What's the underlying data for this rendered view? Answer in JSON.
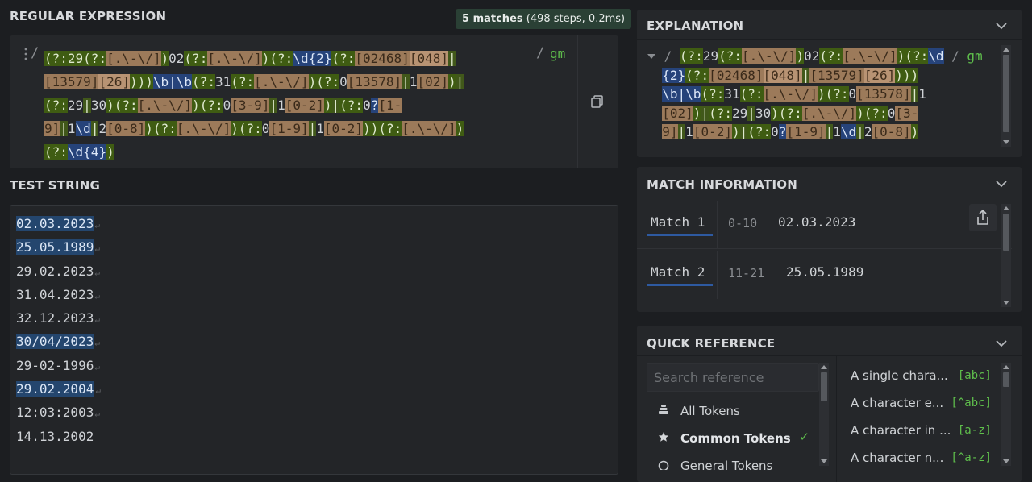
{
  "regex": {
    "title": "REGULAR EXPRESSION",
    "badge_count": "5 matches",
    "badge_detail": " (498 steps, 0.2ms)",
    "delimiter_open": "/",
    "delimiter_close": "/",
    "flags": "gm",
    "lines": [
      [
        [
          "g",
          "(?:"
        ],
        [
          "g",
          "29"
        ],
        [
          "g",
          "(?:"
        ],
        [
          "c",
          "[.\\-\\/]"
        ],
        [
          "g",
          ")"
        ],
        [
          "p",
          "02"
        ],
        [
          "g",
          "(?:"
        ],
        [
          "c",
          "[.\\-\\/]"
        ],
        [
          "g",
          ")"
        ],
        [
          "g",
          "(?:"
        ],
        [
          "b",
          "\\d{2}"
        ],
        [
          "g",
          "(?:"
        ],
        [
          "c",
          "[02468]"
        ],
        [
          "c2",
          "[048]"
        ],
        [
          "pipe",
          "|"
        ]
      ],
      [
        [
          "c",
          "[13579]"
        ],
        [
          "c2",
          "[26]"
        ],
        [
          "g",
          ")))"
        ],
        [
          "b",
          "\\b|\\b"
        ],
        [
          "g",
          "(?:"
        ],
        [
          "p",
          "31"
        ],
        [
          "g",
          "(?:"
        ],
        [
          "c",
          "[.\\-\\/]"
        ],
        [
          "g",
          ")"
        ],
        [
          "g",
          "(?:"
        ],
        [
          "p",
          "0"
        ],
        [
          "c",
          "[13578]"
        ],
        [
          "pipe",
          "|"
        ],
        [
          "p",
          "1"
        ],
        [
          "c",
          "[02]"
        ],
        [
          "g",
          ")"
        ],
        [
          "pipe",
          "|"
        ]
      ],
      [
        [
          "g",
          "(?:"
        ],
        [
          "p",
          "29"
        ],
        [
          "pipe",
          "|"
        ],
        [
          "p",
          "30"
        ],
        [
          "g",
          ")"
        ],
        [
          "g",
          "(?:"
        ],
        [
          "c",
          "[.\\-\\/]"
        ],
        [
          "g",
          ")"
        ],
        [
          "g",
          "(?:"
        ],
        [
          "p",
          "0"
        ],
        [
          "c",
          "[3-9]"
        ],
        [
          "pipe",
          "|"
        ],
        [
          "p",
          "1"
        ],
        [
          "c",
          "[0-2]"
        ],
        [
          "g",
          ")"
        ],
        [
          "pipe",
          "|"
        ],
        [
          "g",
          "(?:"
        ],
        [
          "p",
          "0"
        ],
        [
          "b",
          "?"
        ],
        [
          "c",
          "[1-"
        ]
      ],
      [
        [
          "c",
          "9]"
        ],
        [
          "pipe",
          "|"
        ],
        [
          "p",
          "1"
        ],
        [
          "b",
          "\\d"
        ],
        [
          "pipe",
          "|"
        ],
        [
          "p",
          "2"
        ],
        [
          "c",
          "[0-8]"
        ],
        [
          "g",
          ")"
        ],
        [
          "g",
          "(?:"
        ],
        [
          "c",
          "[.\\-\\/]"
        ],
        [
          "g",
          ")"
        ],
        [
          "g",
          "(?:"
        ],
        [
          "p",
          "0"
        ],
        [
          "c",
          "[1-9]"
        ],
        [
          "pipe",
          "|"
        ],
        [
          "p",
          "1"
        ],
        [
          "c",
          "[0-2]"
        ],
        [
          "g",
          "))"
        ],
        [
          "g",
          "(?:"
        ],
        [
          "c",
          "[.\\-\\/]"
        ],
        [
          "g",
          ")"
        ]
      ],
      [
        [
          "g",
          "(?:"
        ],
        [
          "b",
          "\\d{4}"
        ],
        [
          "g",
          ")"
        ]
      ]
    ]
  },
  "test_string": {
    "title": "TEST STRING",
    "lines": [
      {
        "text": "02.03.2023",
        "match": true
      },
      {
        "text": "25.05.1989",
        "match": true
      },
      {
        "text": "29.02.2023",
        "match": false
      },
      {
        "text": "31.04.2023",
        "match": false
      },
      {
        "text": "32.12.2023",
        "match": false
      },
      {
        "text": "30/04/2023",
        "match": true
      },
      {
        "text": "29-02-1996",
        "match": false
      },
      {
        "text": "29.02.2004",
        "match": true
      },
      {
        "text": "12:03:2003",
        "match": false
      },
      {
        "text": "14.13.2002",
        "match": false
      }
    ],
    "newline_glyph": "↵"
  },
  "explanation": {
    "title": "EXPLANATION",
    "flags": "gm",
    "lines": [
      [
        [
          "g",
          "(?:"
        ],
        [
          "p",
          "29"
        ],
        [
          "g",
          "(?:"
        ],
        [
          "c",
          "[.\\-\\/]"
        ],
        [
          "g",
          ")"
        ],
        [
          "p",
          "02"
        ],
        [
          "g",
          "(?:"
        ],
        [
          "c",
          "[.\\-\\/]"
        ],
        [
          "g",
          ")"
        ],
        [
          "g",
          "(?:"
        ],
        [
          "b",
          "\\d"
        ]
      ],
      [
        [
          "b",
          "{2}"
        ],
        [
          "g",
          "(?:"
        ],
        [
          "c",
          "[02468]"
        ],
        [
          "c2",
          "[048]"
        ],
        [
          "pipe",
          "|"
        ],
        [
          "c",
          "[13579]"
        ],
        [
          "c2",
          "[26]"
        ],
        [
          "g",
          ")))"
        ]
      ],
      [
        [
          "b",
          "\\b|\\b"
        ],
        [
          "g",
          "(?:"
        ],
        [
          "p",
          "31"
        ],
        [
          "g",
          "(?:"
        ],
        [
          "c",
          "[.\\-\\/]"
        ],
        [
          "g",
          ")"
        ],
        [
          "g",
          "(?:"
        ],
        [
          "p",
          "0"
        ],
        [
          "c",
          "[13578]"
        ],
        [
          "pipe",
          "|"
        ],
        [
          "p",
          "1"
        ]
      ],
      [
        [
          "c",
          "[02]"
        ],
        [
          "g",
          ")"
        ],
        [
          "pipe",
          "|"
        ],
        [
          "g",
          "(?:"
        ],
        [
          "p",
          "29"
        ],
        [
          "pipe",
          "|"
        ],
        [
          "p",
          "30"
        ],
        [
          "g",
          ")"
        ],
        [
          "g",
          "(?:"
        ],
        [
          "c",
          "[.\\-\\/]"
        ],
        [
          "g",
          ")"
        ],
        [
          "g",
          "(?:"
        ],
        [
          "p",
          "0"
        ],
        [
          "c",
          "[3-"
        ]
      ],
      [
        [
          "c",
          "9]"
        ],
        [
          "pipe",
          "|"
        ],
        [
          "p",
          "1"
        ],
        [
          "c",
          "[0-2]"
        ],
        [
          "g",
          ")"
        ],
        [
          "pipe",
          "|"
        ],
        [
          "g",
          "(?:"
        ],
        [
          "p",
          "0"
        ],
        [
          "b",
          "?"
        ],
        [
          "c",
          "[1-9]"
        ],
        [
          "pipe",
          "|"
        ],
        [
          "p",
          "1"
        ],
        [
          "b",
          "\\d"
        ],
        [
          "pipe",
          "|"
        ],
        [
          "p",
          "2"
        ],
        [
          "c",
          "[0-8]"
        ],
        [
          "g",
          ")"
        ]
      ]
    ]
  },
  "match_info": {
    "title": "MATCH INFORMATION",
    "rows": [
      {
        "label": "Match 1",
        "range": "0-10",
        "value": "02.03.2023"
      },
      {
        "label": "Match 2",
        "range": "11-21",
        "value": "25.05.1989"
      }
    ]
  },
  "quick_reference": {
    "title": "QUICK REFERENCE",
    "search_placeholder": "Search reference",
    "categories": [
      {
        "label": "All Tokens",
        "icon": "stack-icon",
        "active": false
      },
      {
        "label": "Common Tokens",
        "icon": "star-icon",
        "active": true,
        "check": "✓"
      },
      {
        "label": "General Tokens",
        "icon": "circle-icon",
        "active": false
      }
    ],
    "items": [
      {
        "desc": "A single chara...",
        "code": "[abc]"
      },
      {
        "desc": "A character e...",
        "code": "[^abc]"
      },
      {
        "desc": "A character in ...",
        "code": "[a-z]"
      },
      {
        "desc": "A character n...",
        "code": "[^a-z]"
      }
    ]
  }
}
